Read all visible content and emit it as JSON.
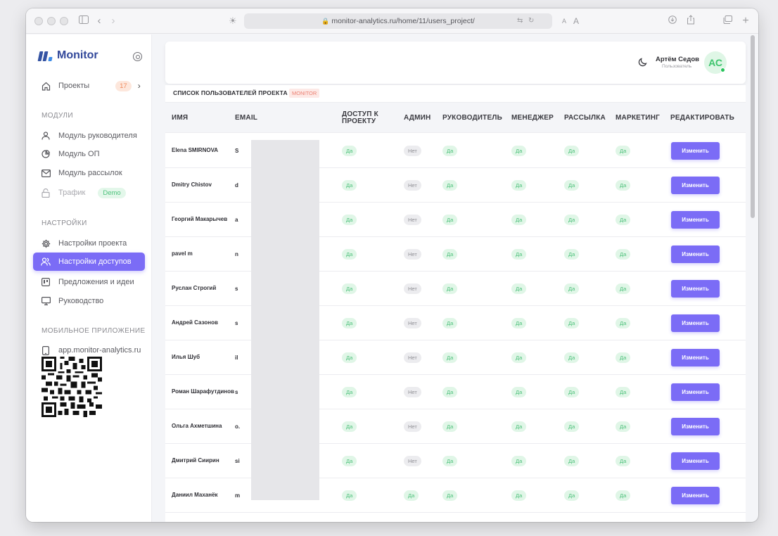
{
  "browser": {
    "url": "monitor-analytics.ru/home/11/users_project/",
    "text_size_small": "A",
    "text_size_large": "A"
  },
  "sidebar": {
    "logo_text": "Monitor",
    "projects": {
      "label": "Проекты",
      "count": "17"
    },
    "modules_title": "МОДУЛИ",
    "modules": [
      {
        "label": "Модуль руководителя",
        "icon": "user-icon"
      },
      {
        "label": "Модуль ОП",
        "icon": "pie-chart-icon"
      },
      {
        "label": "Модуль рассылок",
        "icon": "mail-icon"
      },
      {
        "label": "Трафик",
        "icon": "lock-icon",
        "badge": "Demo"
      }
    ],
    "settings_title": "НАСТРОЙКИ",
    "settings": [
      {
        "label": "Настройки проекта",
        "icon": "gear-icon"
      },
      {
        "label": "Настройки доступов",
        "icon": "users-icon",
        "active": true
      },
      {
        "label": "Предложения и идеи",
        "icon": "board-icon"
      },
      {
        "label": "Руководство",
        "icon": "monitor-icon"
      }
    ],
    "mobile_title": "МОБИЛЬНОЕ ПРИЛОЖЕНИЕ",
    "mobile_link": "app.monitor-analytics.ru"
  },
  "header": {
    "user_name": "Артём Седов",
    "user_role": "Пользователь",
    "avatar_initials": "АС"
  },
  "table": {
    "title": "СПИСОК ПОЛЬЗОВАТЕЛЕЙ ПРОЕКТА",
    "project_badge": "MONITOR",
    "columns": [
      "ИМЯ",
      "EMAIL",
      "ДОСТУП К ПРОЕКТУ",
      "АДМИН",
      "РУКОВОДИТЕЛЬ",
      "МЕНЕДЖЕР",
      "РАССЫЛКА",
      "МАРКЕТИНГ",
      "РЕДАКТИРОВАТЬ"
    ],
    "edit_label": "Изменить",
    "rows": [
      {
        "name": "Elena SMIRNOVA",
        "email": "S",
        "access": "Да",
        "admin": "Нет",
        "head": "Да",
        "manager": "Да",
        "mailing": "Да",
        "marketing": "Да"
      },
      {
        "name": "Dmitry Chistov",
        "email": "d",
        "access": "Да",
        "admin": "Нет",
        "head": "Да",
        "manager": "Да",
        "mailing": "Да",
        "marketing": "Да"
      },
      {
        "name": "Георгий Макарычев",
        "email": "a",
        "access": "Да",
        "admin": "Нет",
        "head": "Да",
        "manager": "Да",
        "mailing": "Да",
        "marketing": "Да"
      },
      {
        "name": "pavel m",
        "email": "n",
        "access": "Да",
        "admin": "Нет",
        "head": "Да",
        "manager": "Да",
        "mailing": "Да",
        "marketing": "Да"
      },
      {
        "name": "Руслан Строгий",
        "email": "s",
        "access": "Да",
        "admin": "Нет",
        "head": "Да",
        "manager": "Да",
        "mailing": "Да",
        "marketing": "Да"
      },
      {
        "name": "Андрей Сазонов",
        "email": "s",
        "access": "Да",
        "admin": "Нет",
        "head": "Да",
        "manager": "Да",
        "mailing": "Да",
        "marketing": "Да"
      },
      {
        "name": "Илья Шуб",
        "email": "il",
        "access": "Да",
        "admin": "Нет",
        "head": "Да",
        "manager": "Да",
        "mailing": "Да",
        "marketing": "Да"
      },
      {
        "name": "Роман Шарафутдинов",
        "email": "s",
        "access": "Да",
        "admin": "Нет",
        "head": "Да",
        "manager": "Да",
        "mailing": "Да",
        "marketing": "Да"
      },
      {
        "name": "Ольга Ахметшина",
        "email": "o.",
        "access": "Да",
        "admin": "Нет",
        "head": "Да",
        "manager": "Да",
        "mailing": "Да",
        "marketing": "Да"
      },
      {
        "name": "Дмитрий Сиирин",
        "email": "si",
        "access": "Да",
        "admin": "Нет",
        "head": "Да",
        "manager": "Да",
        "mailing": "Да",
        "marketing": "Да"
      },
      {
        "name": "Даниил Маханёк",
        "email": "m",
        "access": "Да",
        "admin": "Да",
        "head": "Да",
        "manager": "Да",
        "mailing": "Да",
        "marketing": "Да"
      }
    ]
  }
}
